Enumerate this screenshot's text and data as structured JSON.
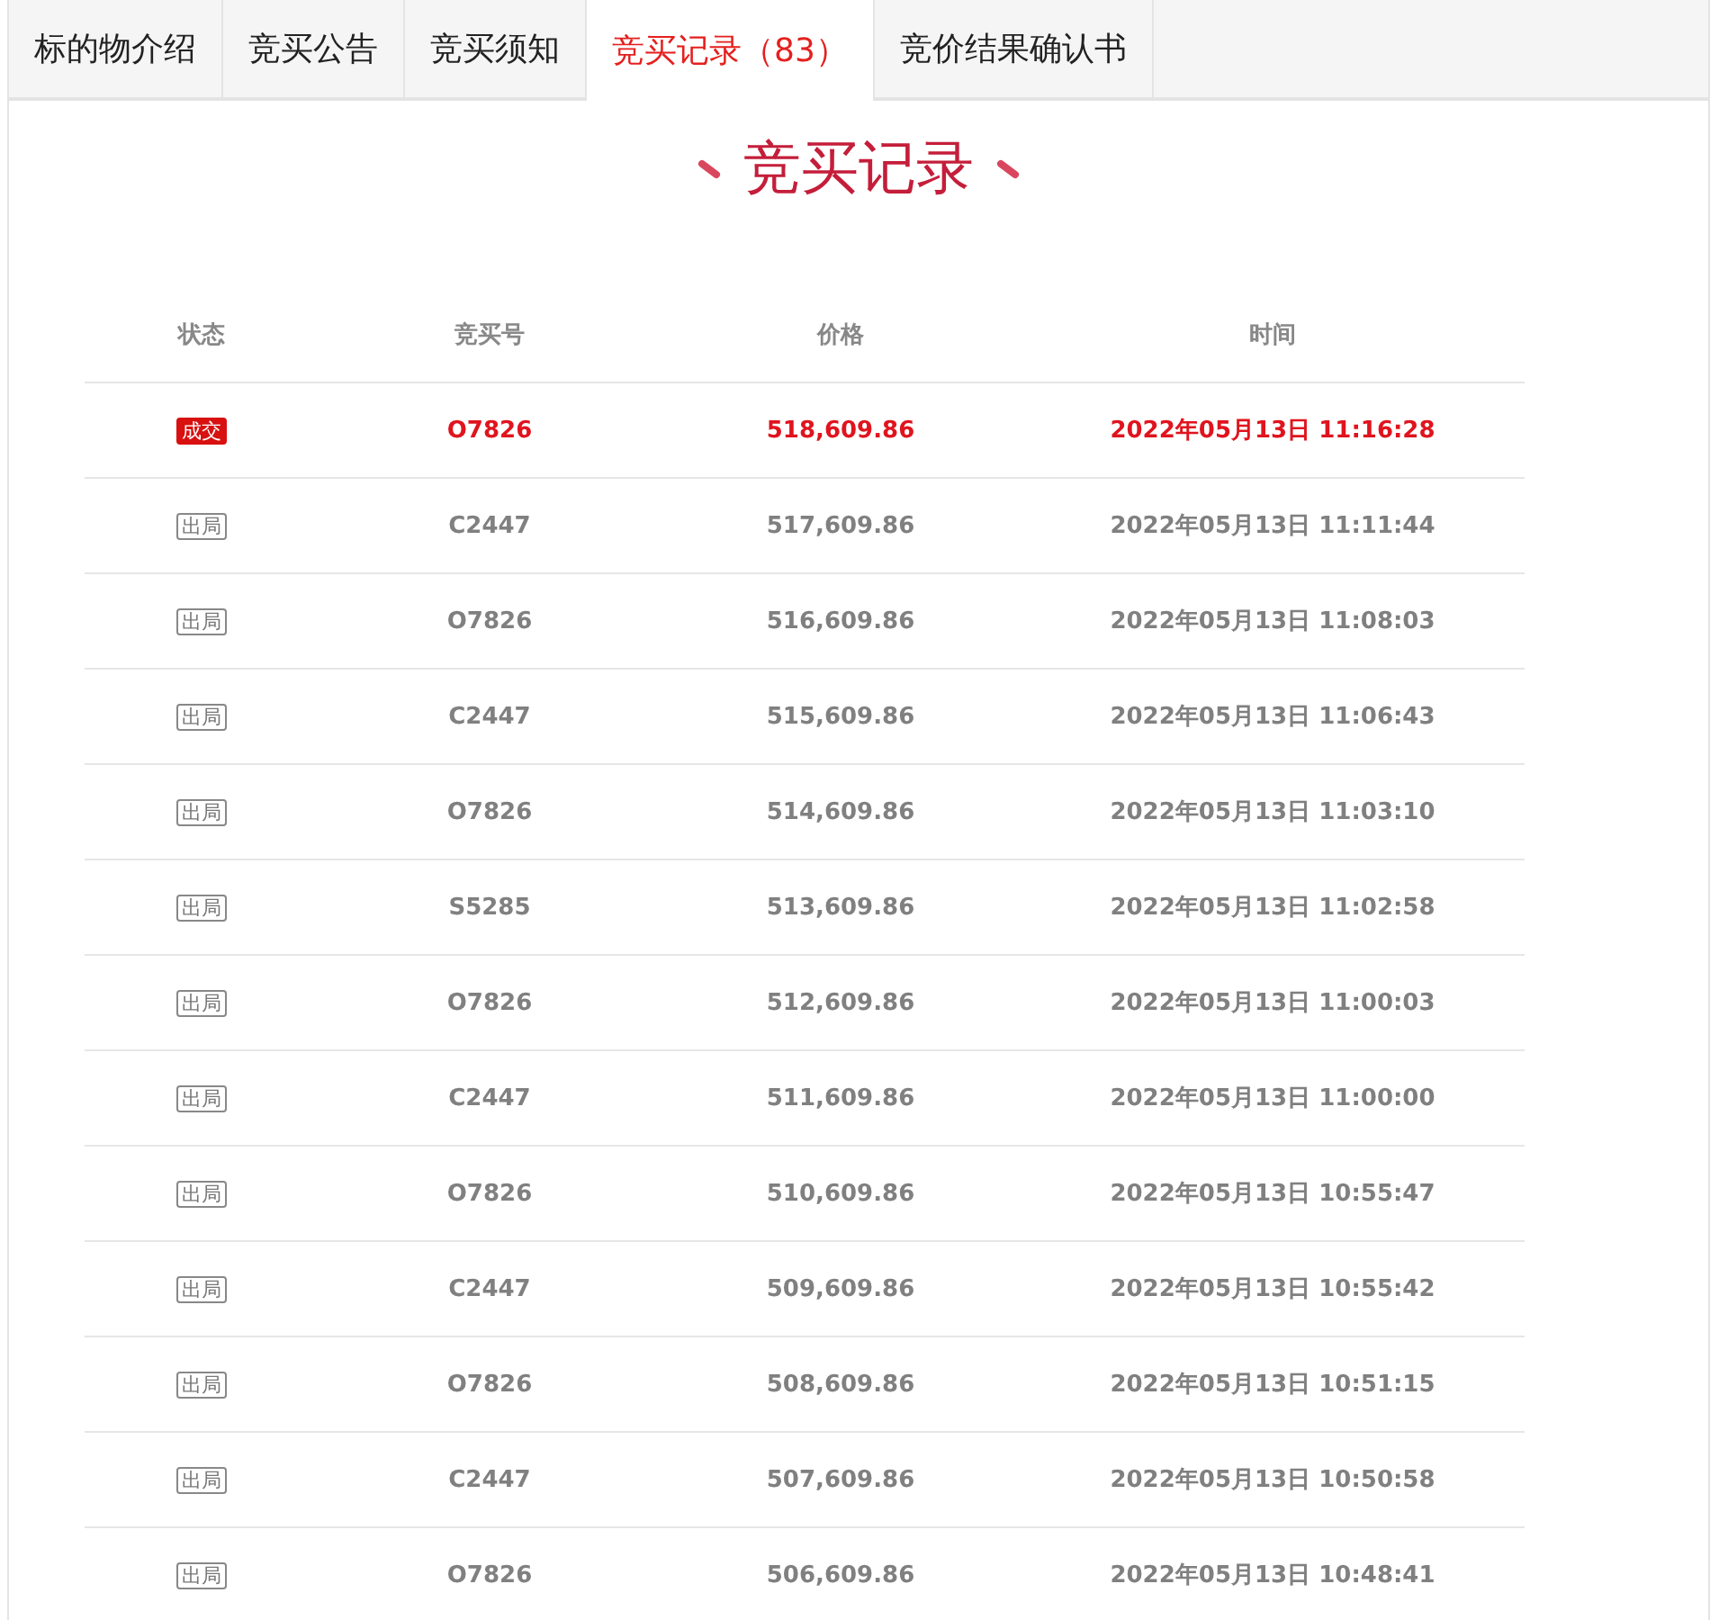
{
  "tabs": [
    {
      "label": "标的物介绍",
      "selected": false
    },
    {
      "label": "竞买公告",
      "selected": false
    },
    {
      "label": "竞买须知",
      "selected": false
    },
    {
      "label": "竞买记录（83）",
      "selected": true
    },
    {
      "label": "竞价结果确认书",
      "selected": false
    }
  ],
  "title": "竞买记录",
  "table": {
    "columns": [
      "状态",
      "竞买号",
      "价格",
      "时间"
    ],
    "rows": [
      {
        "kind": "won",
        "status": "成交",
        "bidder": "O7826",
        "price": "518,609.86",
        "time": "2022年05月13日 11:16:28"
      },
      {
        "kind": "outbid",
        "status": "出局",
        "bidder": "C2447",
        "price": "517,609.86",
        "time": "2022年05月13日 11:11:44"
      },
      {
        "kind": "outbid",
        "status": "出局",
        "bidder": "O7826",
        "price": "516,609.86",
        "time": "2022年05月13日 11:08:03"
      },
      {
        "kind": "outbid",
        "status": "出局",
        "bidder": "C2447",
        "price": "515,609.86",
        "time": "2022年05月13日 11:06:43"
      },
      {
        "kind": "outbid",
        "status": "出局",
        "bidder": "O7826",
        "price": "514,609.86",
        "time": "2022年05月13日 11:03:10"
      },
      {
        "kind": "outbid",
        "status": "出局",
        "bidder": "S5285",
        "price": "513,609.86",
        "time": "2022年05月13日 11:02:58"
      },
      {
        "kind": "outbid",
        "status": "出局",
        "bidder": "O7826",
        "price": "512,609.86",
        "time": "2022年05月13日 11:00:03"
      },
      {
        "kind": "outbid",
        "status": "出局",
        "bidder": "C2447",
        "price": "511,609.86",
        "time": "2022年05月13日 11:00:00"
      },
      {
        "kind": "outbid",
        "status": "出局",
        "bidder": "O7826",
        "price": "510,609.86",
        "time": "2022年05月13日 10:55:47"
      },
      {
        "kind": "outbid",
        "status": "出局",
        "bidder": "C2447",
        "price": "509,609.86",
        "time": "2022年05月13日 10:55:42"
      },
      {
        "kind": "outbid",
        "status": "出局",
        "bidder": "O7826",
        "price": "508,609.86",
        "time": "2022年05月13日 10:51:15"
      },
      {
        "kind": "outbid",
        "status": "出局",
        "bidder": "C2447",
        "price": "507,609.86",
        "time": "2022年05月13日 10:50:58"
      },
      {
        "kind": "outbid",
        "status": "出局",
        "bidder": "O7826",
        "price": "506,609.86",
        "time": "2022年05月13日 10:48:41"
      }
    ]
  }
}
